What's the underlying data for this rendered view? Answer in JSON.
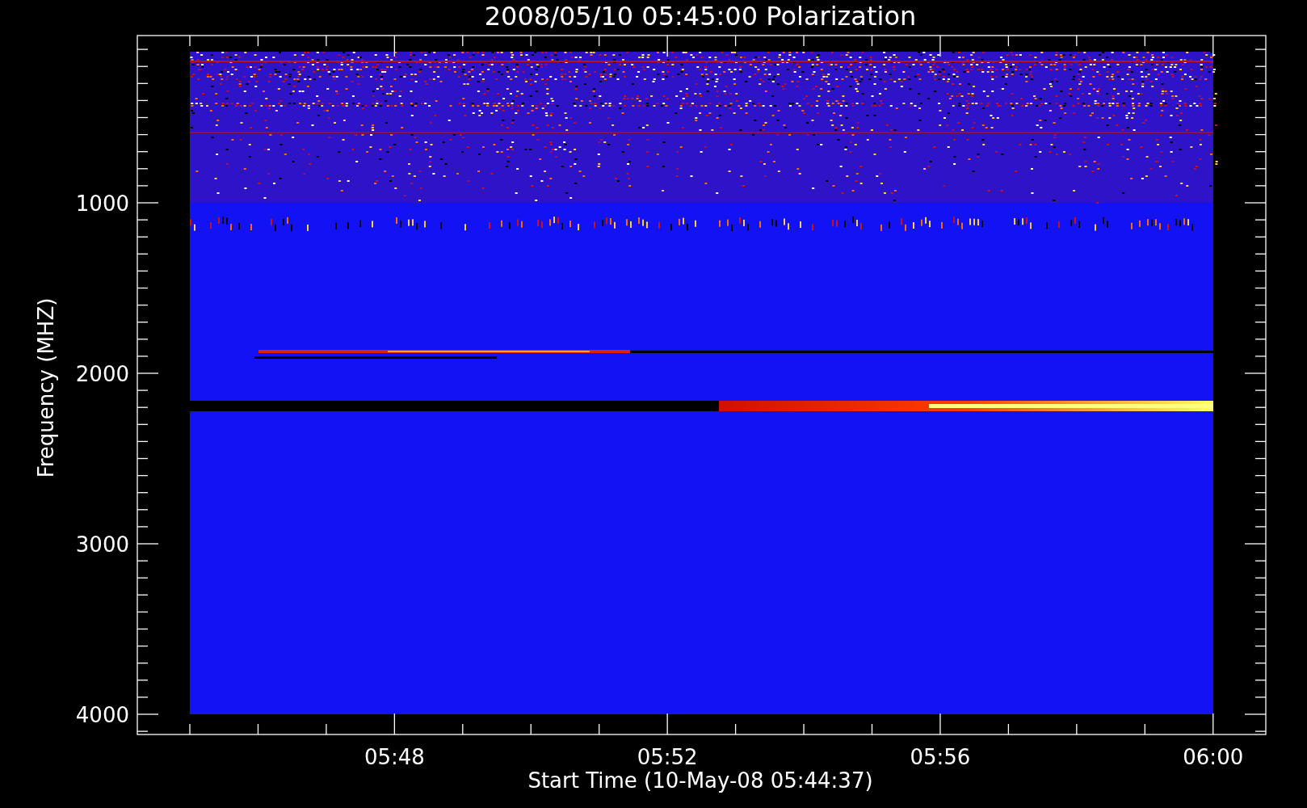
{
  "title": "2008/05/10 05:45:00 Polarization",
  "ylabel": "Frequency (MHZ)",
  "xlabel": "Start Time (10-May-08 05:44:37)",
  "yticks": [
    "1000",
    "2000",
    "3000",
    "4000"
  ],
  "xticks": [
    "05:48",
    "05:52",
    "05:56",
    "06:00"
  ]
}
